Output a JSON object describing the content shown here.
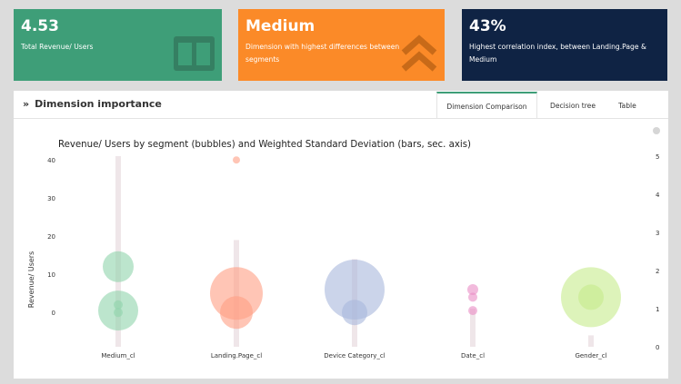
{
  "kpis": [
    {
      "value": "4.53",
      "label": "Total Revenue/ Users",
      "color": "#3e9e78",
      "icon": "book-columns-icon"
    },
    {
      "value": "Medium",
      "label": "Dimension with highest differences between segments",
      "color": "#fb8a28",
      "icon": "double-chevron-up-icon"
    },
    {
      "value": "43%",
      "label": "Highest correlation index, between Landing.Page & Medium",
      "color": "#0f2344",
      "icon": "corner-arrow-icon"
    }
  ],
  "panel": {
    "title": "Dimension importance",
    "tabs": [
      "Dimension Comparison",
      "Decision tree",
      "Table"
    ],
    "active_tab": 0
  },
  "chart_data": {
    "type": "bubble-bar",
    "title": "Revenue/ Users by segment (bubbles) and Weighted Standard Deviation (bars, sec. axis)",
    "ylabel": "Revenue/ Users",
    "ylabel_right": "",
    "categories": [
      "Medium_cl",
      "Landing.Page_cl",
      "Device Category_cl",
      "Date_cl",
      "Gender_cl"
    ],
    "yticks": [
      0,
      10,
      20,
      30,
      40
    ],
    "y2ticks": [
      0,
      1,
      2,
      3,
      4,
      5
    ],
    "ylim": [
      -9,
      41
    ],
    "y2lim": [
      0,
      5
    ],
    "bars": {
      "name": "Weighted Standard Deviation",
      "color": "#efe6e9",
      "values": [
        5.0,
        2.8,
        2.3,
        1.0,
        0.3
      ]
    },
    "bubbles": [
      {
        "category": "Medium_cl",
        "color": "#8fd4ab",
        "points": [
          {
            "y": 12,
            "size": 17
          },
          {
            "y": 0.5,
            "size": 22
          },
          {
            "y": 2,
            "size": 5
          },
          {
            "y": 0,
            "size": 5
          }
        ]
      },
      {
        "category": "Landing.Page_cl",
        "color": "#ff9f84",
        "points": [
          {
            "y": 40,
            "size": 4
          },
          {
            "y": 5,
            "size": 29
          },
          {
            "y": 0,
            "size": 18
          }
        ]
      },
      {
        "category": "Device Category_cl",
        "color": "#a9b7dc",
        "points": [
          {
            "y": 6,
            "size": 33
          },
          {
            "y": 0,
            "size": 14
          }
        ]
      },
      {
        "category": "Date_cl",
        "color": "#e98cc4",
        "points": [
          {
            "y": 6,
            "size": 6
          },
          {
            "y": 4,
            "size": 5
          },
          {
            "y": 0.5,
            "size": 5
          }
        ]
      },
      {
        "category": "Gender_cl",
        "color": "#c7eb8c",
        "points": [
          {
            "y": 4,
            "size": 33
          },
          {
            "y": 4,
            "size": 14
          }
        ]
      }
    ],
    "grid": false,
    "legend": "none"
  }
}
